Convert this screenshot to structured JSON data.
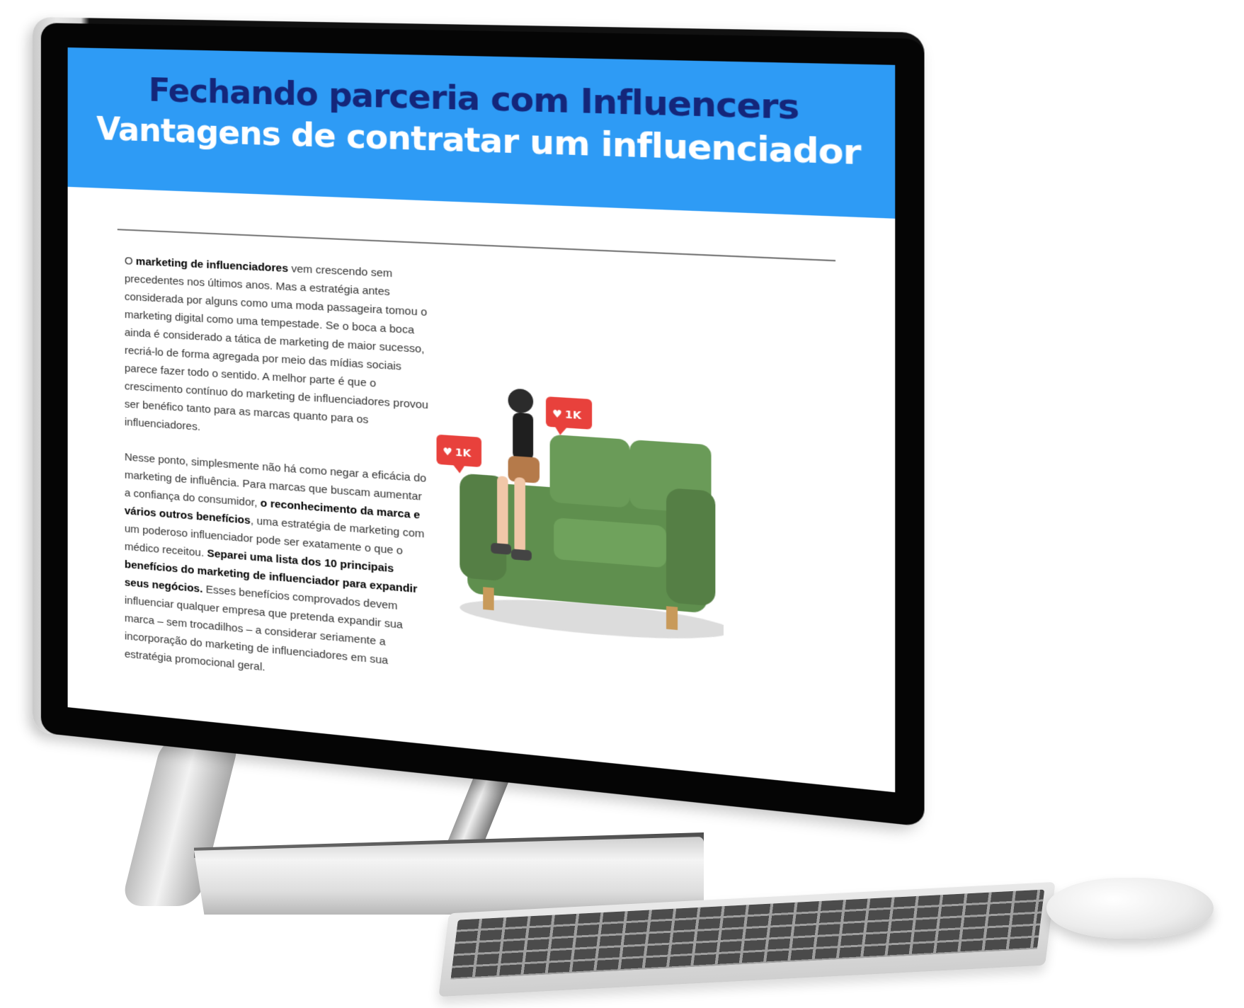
{
  "page": {
    "title_line1": "Fechando parceria com Influencers",
    "title_line2": "Vantagens de contratar um influenciador"
  },
  "article": {
    "p1": {
      "lead": "O ",
      "bold1": "marketing de influenciadores",
      "rest": " vem crescendo sem precedentes nos últimos anos. Mas a estratégia antes considerada por alguns como uma moda passageira tomou o marketing digital como uma tempestade. Se o boca a boca ainda é considerado a tática de marketing de maior sucesso, recriá-lo de forma agregada por meio das mídias sociais parece fazer todo o sentido. A melhor parte é que o crescimento contínuo do marketing de influenciadores provou ser benéfico tanto para as marcas quanto para os influenciadores."
    },
    "p2": {
      "part1": "Nesse ponto, simplesmente não há como negar a eficácia do marketing de influência. Para marcas que buscam aumentar a confiança do consumidor, ",
      "bold1": "o reconhecimento da marca e vários outros benefícios",
      "part2": ", uma estratégia de marketing com um poderoso influenciador pode ser exatamente o que o médico receitou. ",
      "bold2": "Separei uma lista dos 10 principais benefícios do marketing de influenciador para expandir seus negócios.",
      "part3": " Esses benefícios comprovados devem influenciar qualquer empresa que pretenda expandir sua marca – sem trocadilhos – a considerar seriamente a incorporação do marketing de influenciadores em sua estratégia promocional geral."
    }
  },
  "illustration": {
    "badge_left": "1K",
    "badge_right": "1K"
  },
  "colors": {
    "header_bg": "#2e9bf5",
    "title_dark": "#14267a",
    "badge_red": "#e8413c",
    "sofa_green": "#5f8f4e"
  }
}
